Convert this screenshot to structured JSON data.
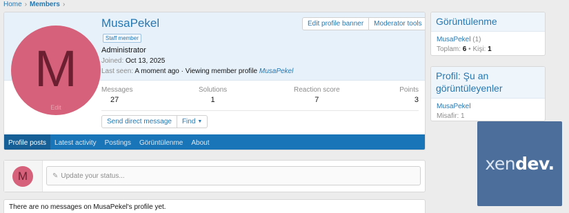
{
  "breadcrumb": {
    "home": "Home",
    "members": "Members",
    "sep": "›"
  },
  "profile": {
    "username": "MusaPekel",
    "badge": "Staff member",
    "role": "Administrator",
    "joined_label": "Joined:",
    "joined_value": "Oct 13, 2025",
    "last_seen_label": "Last seen:",
    "last_seen_value": "A moment ago · Viewing member profile",
    "last_seen_link": "MusaPekel",
    "avatar_letter": "M",
    "avatar_edit": "Edit",
    "avatar_color": "#d6617a"
  },
  "header_buttons": {
    "edit_banner": "Edit profile banner",
    "moderator_tools": "Moderator tools"
  },
  "stats": [
    {
      "label": "Messages",
      "value": "27"
    },
    {
      "label": "Solutions",
      "value": "1"
    },
    {
      "label": "Reaction score",
      "value": "7"
    },
    {
      "label": "Points",
      "value": "3"
    }
  ],
  "actions": {
    "send_dm": "Send direct message",
    "find": "Find"
  },
  "tabs": [
    "Profile posts",
    "Latest activity",
    "Postings",
    "Görüntülenme",
    "About"
  ],
  "status": {
    "placeholder": "Update your status...",
    "avatar_letter": "M"
  },
  "no_messages": "There are no messages on MusaPekel's profile yet.",
  "sidebar": {
    "views": {
      "title": "Görüntülenme",
      "user": "MusaPekel",
      "user_count": "(1)",
      "total_label": "Toplam:",
      "total_value": "6",
      "persons_label": "Kişi:",
      "persons_value": "1"
    },
    "viewing": {
      "title": "Profil: Şu an görüntüleyenler",
      "user": "MusaPekel",
      "guests": "Misafir: 1"
    }
  },
  "ad": {
    "part1": "xen",
    "part2": "dev."
  },
  "colors": {
    "accent": "#2577b1",
    "nav": "#1a75b8",
    "header_bg": "#e7f1fa",
    "ad_bg": "#4b6e9a"
  }
}
